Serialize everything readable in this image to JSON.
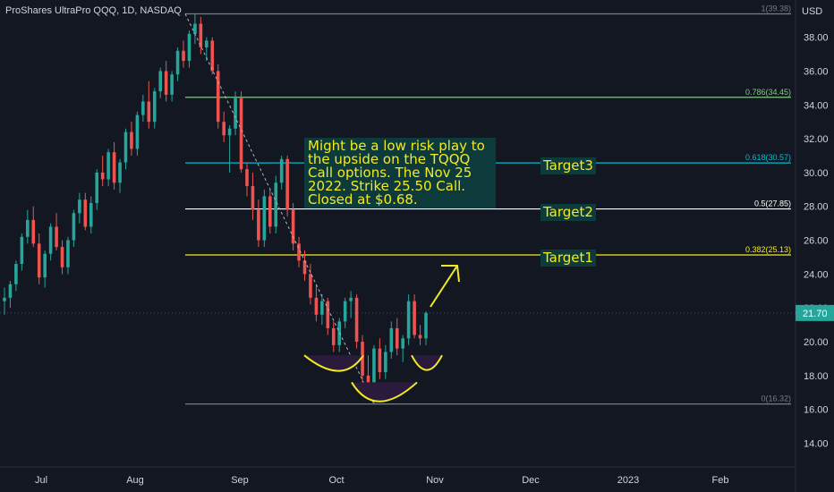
{
  "header": {
    "symbol_title": "ProShares UltraPro QQQ, 1D, NASDAQ"
  },
  "currency": "USD",
  "price_label": "21.70",
  "colors": {
    "up": "#26a69a",
    "down": "#ef5350",
    "bg": "#131722",
    "accent_yellow": "#f5e91f"
  },
  "annotations": {
    "note": "Might be a low risk play to the upside on the TQQQ Call options. The Nov 25 2022. Strike 25.50 Call. Closed at $0.68.",
    "target1": "Target1",
    "target2": "Target2",
    "target3": "Target3"
  },
  "chart_data": {
    "type": "candlestick",
    "title": "ProShares UltraPro QQQ, 1D, NASDAQ",
    "ylabel": "USD",
    "ylim": [
      12.6,
      40.2
    ],
    "y_ticks": [
      "14.00",
      "16.00",
      "18.00",
      "20.00",
      "22.00",
      "24.00",
      "26.00",
      "28.00",
      "30.00",
      "32.00",
      "34.00",
      "36.00",
      "38.00"
    ],
    "x_ticks": [
      "Jul",
      "Aug",
      "Sep",
      "Oct",
      "Nov",
      "Dec",
      "2023",
      "Feb"
    ],
    "fib_levels": [
      {
        "label": "1(39.38)",
        "value": 39.38,
        "color": "#787b86"
      },
      {
        "label": "0.786(34.45)",
        "value": 34.45,
        "color": "#81c784"
      },
      {
        "label": "0.618(30.57)",
        "value": 30.57,
        "color": "#00bcd4"
      },
      {
        "label": "0.5(27.85)",
        "value": 27.85,
        "color": "#ffffff"
      },
      {
        "label": "0.382(25.13)",
        "value": 25.13,
        "color": "#f5e91f"
      },
      {
        "label": "0(16.32)",
        "value": 16.32,
        "color": "#787b86"
      }
    ],
    "last_price": 21.7,
    "candles": [
      [
        22.4,
        23.2,
        21.6,
        22.6
      ],
      [
        22.6,
        23.6,
        22.0,
        23.4
      ],
      [
        23.4,
        24.8,
        23.0,
        24.6
      ],
      [
        24.6,
        26.4,
        24.2,
        26.2
      ],
      [
        26.2,
        27.8,
        25.8,
        27.2
      ],
      [
        27.2,
        28.0,
        25.6,
        25.8
      ],
      [
        25.8,
        26.4,
        23.4,
        23.8
      ],
      [
        23.8,
        25.4,
        23.2,
        25.2
      ],
      [
        25.2,
        27.0,
        24.8,
        26.8
      ],
      [
        26.8,
        27.6,
        25.4,
        25.6
      ],
      [
        25.6,
        26.0,
        24.0,
        24.4
      ],
      [
        24.4,
        26.2,
        24.0,
        26.0
      ],
      [
        26.0,
        27.8,
        25.6,
        27.6
      ],
      [
        27.6,
        28.8,
        27.0,
        28.4
      ],
      [
        28.4,
        28.8,
        26.6,
        26.8
      ],
      [
        26.8,
        28.6,
        26.4,
        28.2
      ],
      [
        28.2,
        30.2,
        27.8,
        30.0
      ],
      [
        30.0,
        31.0,
        29.2,
        29.6
      ],
      [
        29.6,
        31.4,
        29.2,
        31.2
      ],
      [
        31.2,
        31.8,
        29.0,
        29.4
      ],
      [
        29.4,
        30.8,
        28.8,
        30.6
      ],
      [
        30.6,
        32.6,
        30.2,
        32.4
      ],
      [
        32.4,
        33.0,
        31.0,
        31.4
      ],
      [
        31.4,
        33.6,
        31.0,
        33.4
      ],
      [
        33.4,
        34.6,
        33.0,
        34.2
      ],
      [
        34.2,
        35.4,
        32.6,
        33.0
      ],
      [
        33.0,
        35.0,
        32.6,
        34.8
      ],
      [
        34.8,
        36.2,
        34.4,
        36.0
      ],
      [
        36.0,
        36.6,
        34.2,
        34.6
      ],
      [
        34.6,
        36.0,
        34.2,
        35.8
      ],
      [
        35.8,
        37.4,
        35.4,
        37.2
      ],
      [
        37.2,
        37.8,
        36.2,
        36.6
      ],
      [
        36.6,
        38.4,
        36.2,
        38.2
      ],
      [
        38.2,
        39.4,
        37.6,
        38.8
      ],
      [
        38.8,
        39.2,
        37.0,
        37.4
      ],
      [
        37.4,
        38.0,
        36.6,
        37.8
      ],
      [
        37.8,
        38.0,
        35.8,
        36.0
      ],
      [
        36.0,
        36.4,
        32.6,
        33.0
      ],
      [
        33.0,
        33.6,
        31.8,
        32.2
      ],
      [
        32.2,
        32.8,
        30.0,
        32.6
      ],
      [
        32.6,
        34.8,
        32.2,
        34.4
      ],
      [
        34.4,
        34.8,
        30.0,
        30.2
      ],
      [
        30.2,
        30.6,
        28.6,
        29.2
      ],
      [
        29.2,
        30.0,
        27.2,
        27.8
      ],
      [
        27.8,
        28.4,
        25.6,
        26.0
      ],
      [
        26.0,
        29.0,
        25.6,
        28.6
      ],
      [
        28.6,
        29.0,
        26.4,
        26.8
      ],
      [
        26.8,
        29.8,
        26.4,
        29.4
      ],
      [
        29.4,
        31.0,
        29.0,
        30.8
      ],
      [
        30.8,
        31.0,
        27.4,
        27.8
      ],
      [
        27.8,
        28.2,
        25.4,
        25.8
      ],
      [
        25.8,
        26.2,
        24.4,
        24.8
      ],
      [
        24.8,
        25.4,
        23.6,
        24.0
      ],
      [
        24.0,
        24.6,
        22.2,
        22.6
      ],
      [
        22.6,
        23.4,
        21.2,
        21.6
      ],
      [
        21.6,
        22.8,
        21.0,
        22.4
      ],
      [
        22.4,
        22.6,
        20.4,
        20.8
      ],
      [
        20.8,
        21.2,
        19.4,
        19.8
      ],
      [
        19.8,
        21.4,
        19.4,
        21.2
      ],
      [
        21.2,
        22.6,
        20.8,
        22.4
      ],
      [
        22.4,
        23.0,
        21.4,
        22.6
      ],
      [
        22.6,
        22.8,
        19.6,
        20.0
      ],
      [
        20.0,
        20.4,
        17.6,
        18.0
      ],
      [
        18.0,
        19.2,
        16.8,
        17.4
      ],
      [
        17.4,
        19.8,
        16.3,
        19.6
      ],
      [
        19.6,
        20.2,
        17.8,
        18.2
      ],
      [
        18.2,
        19.8,
        17.8,
        19.4
      ],
      [
        19.4,
        21.2,
        19.0,
        20.8
      ],
      [
        20.8,
        21.4,
        19.2,
        19.6
      ],
      [
        19.6,
        20.4,
        18.8,
        20.2
      ],
      [
        20.2,
        22.8,
        19.8,
        22.4
      ],
      [
        22.4,
        22.8,
        20.2,
        20.4
      ],
      [
        20.4,
        21.0,
        19.8,
        20.2
      ],
      [
        20.2,
        21.8,
        19.8,
        21.7
      ]
    ]
  }
}
